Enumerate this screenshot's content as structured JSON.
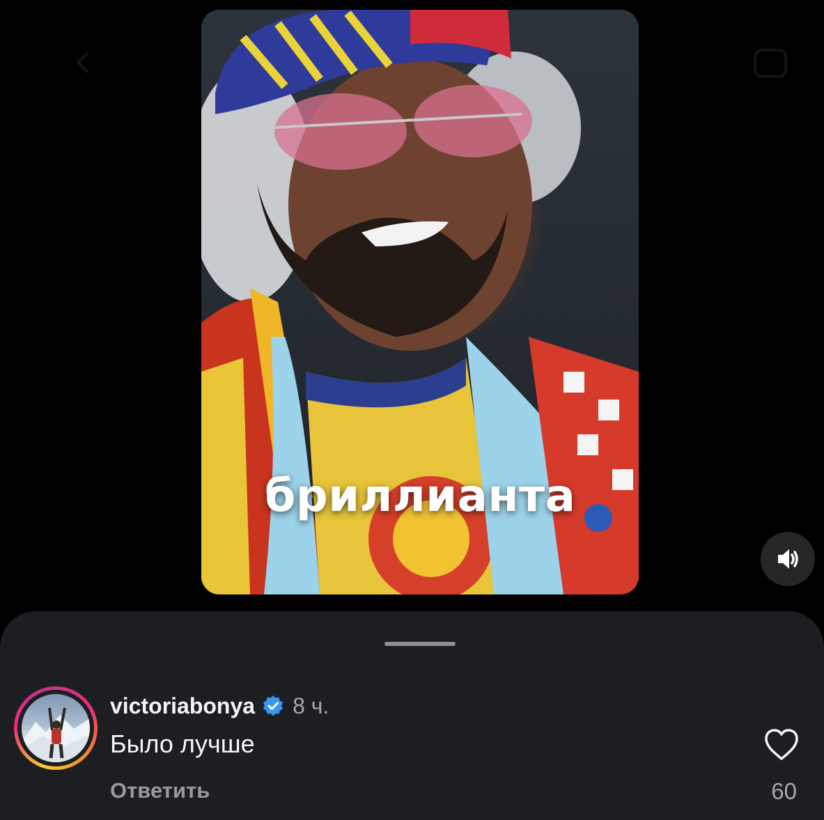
{
  "video": {
    "caption": "бриллианта"
  },
  "colors": {
    "background": "#000000",
    "sheet": "#1c1e22",
    "verified": "#3897f0",
    "muted_text": "#a8a8a8"
  },
  "icons": {
    "sound": "speaker-volume-icon",
    "verified": "verified-badge-icon",
    "like": "heart-outline-icon"
  },
  "comment": {
    "username": "victoriabonya",
    "time": "8 ч.",
    "text": "Было лучше",
    "reply_label": "Ответить",
    "like_count": "60"
  }
}
